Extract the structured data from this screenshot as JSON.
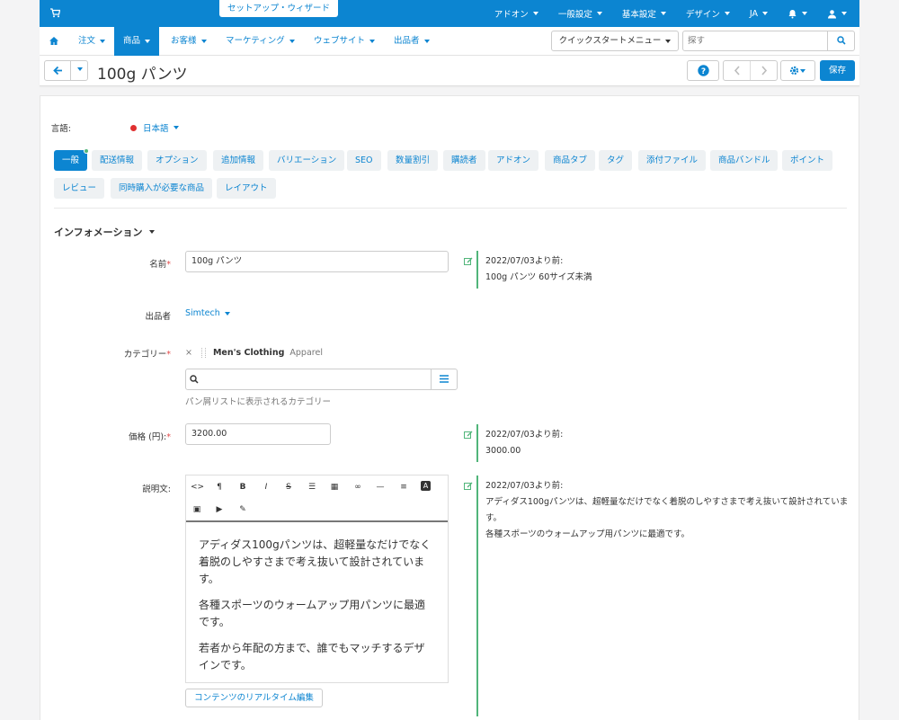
{
  "topbar": {
    "wizard": "セットアップ・ウィザード",
    "menu": [
      "アドオン",
      "一般設定",
      "基本設定",
      "デザイン",
      "JA"
    ]
  },
  "nav": {
    "items": [
      "注文",
      "商品",
      "お客様",
      "マーケティング",
      "ウェブサイト",
      "出品者"
    ],
    "active": "商品",
    "quickstart": "クイックスタートメニュー",
    "search_placeholder": "探す"
  },
  "toolbar": {
    "title": "100g パンツ",
    "save": "保存"
  },
  "language": {
    "label": "言語:",
    "value": "日本語"
  },
  "tabs": [
    "一般",
    "配送情報",
    "オプション",
    "追加情報",
    "バリエーション",
    "SEO",
    "数量割引",
    "購読者",
    "アドオン",
    "商品タブ",
    "タグ",
    "添付ファイル",
    "商品バンドル",
    "ポイント",
    "レビュー",
    "同時購入が必要な商品",
    "レイアウト"
  ],
  "section": "インフォメーション",
  "fields": {
    "name_label": "名前",
    "name_value": "100g パンツ",
    "name_hist_date": "2022/07/03より前:",
    "name_hist_value": "100g パンツ 60サイズ未満",
    "vendor_label": "出品者",
    "vendor_value": "Simtech",
    "category_label": "カテゴリー",
    "category_remove": "×",
    "category_name": "Men's Clothing",
    "category_parent": "Apparel",
    "category_hint": "パン屑リストに表示されるカテゴリー",
    "price_label": "価格 (円):",
    "price_value": "3200.00",
    "price_hist_date": "2022/07/03より前:",
    "price_hist_value": "3000.00",
    "desc_label": "説明文:",
    "desc_hist_date": "2022/07/03より前:",
    "desc_hist_line1": "アディダス100gパンツは、超軽量なだけでなく着脱のしやすさまで考え抜いて設計されていま",
    "desc_hist_line2": "す。",
    "desc_hist_line3": "各種スポーツのウォームアップ用パンツに最適です。",
    "desc_p1": "アディダス100gパンツは、超軽量なだけでなく着脱のしやすさまで考え抜いて設計されています。",
    "desc_p2": "各種スポーツのウォームアップ用パンツに最適です。",
    "desc_p3": "若者から年配の方まで、誰でもマッチするデザインです。",
    "live_edit": "コンテンツのリアルタイム編集"
  },
  "icons": {
    "cart": "cart-icon",
    "bell": "bell-icon",
    "user": "user-icon",
    "home": "home-icon",
    "search": "search-icon",
    "back": "arrow-left-icon",
    "help": "help-icon",
    "gear": "gear-icon",
    "edit": "edit-icon",
    "list": "list-icon"
  },
  "colors": {
    "primary": "#0c85d1",
    "history_bar": "#51b57a",
    "required": "#e34a4a"
  }
}
